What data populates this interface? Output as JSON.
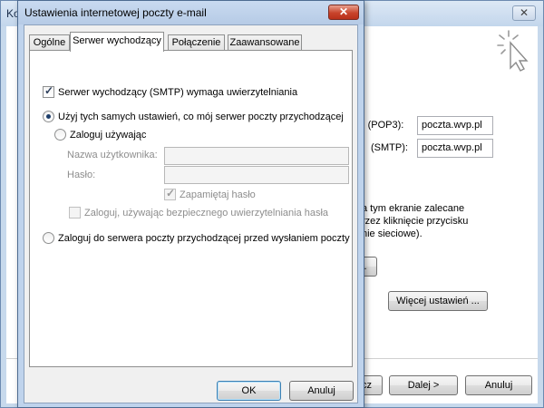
{
  "background_window": {
    "title_fragment": "Ko",
    "close_glyph": "✕",
    "pop3_label": "ej (POP3):",
    "pop3_value": "poczta.wvp.pl",
    "smtp_label": "(SMTP):",
    "smtp_value": "poczta.wvp.pl",
    "info_line1": "a tym ekranie zalecane",
    "info_line2": "rzez kliknięcie przycisku",
    "info_line3": "nie sieciowe).",
    "partial_button": ".",
    "more_settings_button": "Więcej ustawień ...",
    "back_button_fragment": "cz",
    "next_button": "Dalej >",
    "cancel_button": "Anuluj"
  },
  "dialog": {
    "title": "Ustawienia internetowej poczty e-mail",
    "close_glyph": "✕",
    "tabs": [
      {
        "label": "Ogólne"
      },
      {
        "label": "Serwer wychodzący"
      },
      {
        "label": "Połączenie"
      },
      {
        "label": "Zaawansowane"
      }
    ],
    "smtp_auth_checkbox": "Serwer wychodzący (SMTP) wymaga uwierzytelniania",
    "radio_same_settings": "Użyj tych samych ustawień, co mój serwer poczty przychodzącej",
    "radio_login_using": "Zaloguj używając",
    "username_label": "Nazwa użytkownika:",
    "username_value": "",
    "password_label": "Hasło:",
    "password_value": "",
    "remember_password": "Zapamiętaj hasło",
    "secure_auth": "Zaloguj, używając bezpiecznego uwierzytelniania hasła",
    "radio_login_incoming_first": "Zaloguj do serwera poczty przychodzącej przed wysłaniem poczty",
    "ok_button": "OK",
    "cancel_button": "Anuluj"
  },
  "colors": {
    "dialog_frame": "#bfd3ec",
    "close_button_red": "#c8432b",
    "ok_button_border": "#3c7fb1"
  }
}
